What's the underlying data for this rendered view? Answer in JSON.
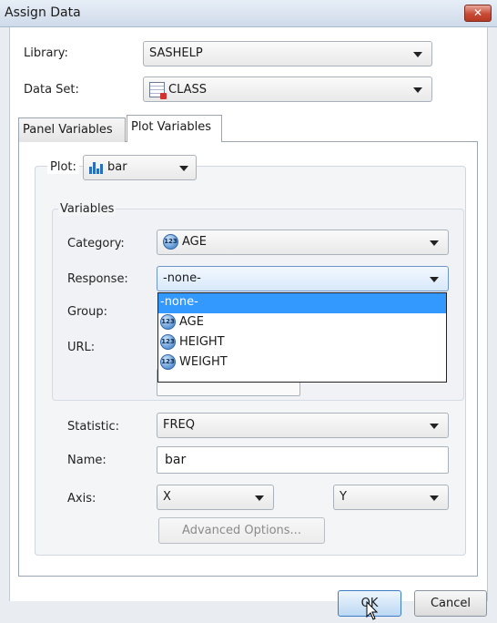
{
  "window": {
    "title": "Assign Data",
    "close_label": "✕"
  },
  "library": {
    "label": "Library:",
    "value": "SASHELP"
  },
  "dataset": {
    "label": "Data Set:",
    "value": "CLASS"
  },
  "tabs": [
    {
      "label": "Panel Variables",
      "active": false
    },
    {
      "label": "Plot Variables",
      "active": true
    }
  ],
  "plot": {
    "label": "Plot:",
    "value": "bar"
  },
  "variables": {
    "title": "Variables",
    "category": {
      "label": "Category:",
      "value": "AGE",
      "icon_text": "123"
    },
    "response": {
      "label": "Response:",
      "value": "-none-"
    },
    "group": {
      "label": "Group:"
    },
    "url": {
      "label": "URL:"
    },
    "response_options": [
      {
        "label": "-none-",
        "selected": true
      },
      {
        "label": "AGE",
        "icon_text": "123"
      },
      {
        "label": "HEIGHT",
        "icon_text": "123"
      },
      {
        "label": "WEIGHT",
        "icon_text": "123"
      }
    ]
  },
  "statistic": {
    "label": "Statistic:",
    "value": "FREQ"
  },
  "name": {
    "label": "Name:",
    "value": "bar"
  },
  "axis": {
    "label": "Axis:",
    "x_value": "X",
    "y_value": "Y"
  },
  "buttons": {
    "advanced": "Advanced Options...",
    "ok": "OK",
    "cancel": "Cancel"
  },
  "colors": {
    "selection": "#3399ff",
    "close": "#c84a34",
    "title_bar": "#dbe4ef"
  }
}
